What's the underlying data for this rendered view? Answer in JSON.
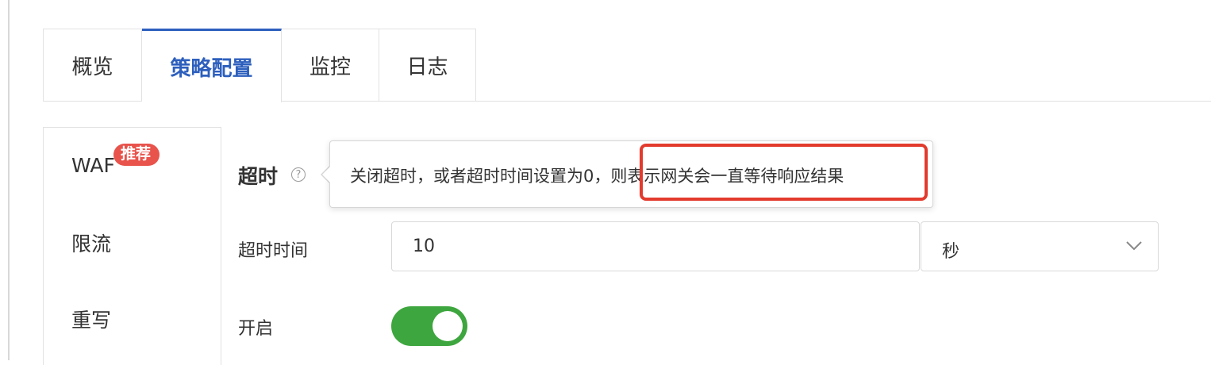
{
  "tabs": [
    {
      "label": "概览"
    },
    {
      "label": "策略配置",
      "active": true
    },
    {
      "label": "监控"
    },
    {
      "label": "日志"
    }
  ],
  "subnav": {
    "items": [
      {
        "label": "WAF"
      },
      {
        "label": "限流"
      },
      {
        "label": "重写"
      }
    ],
    "badge": "推荐"
  },
  "section": {
    "title": "超时",
    "help_icon": "question-circle-icon",
    "tooltip": {
      "text_prefix": "关闭超时，或者超时时间设置为0，",
      "text_highlight": "则表示网关会一直等待响应结果"
    }
  },
  "timeout": {
    "label": "超时时间",
    "value": "10",
    "unit": "秒"
  },
  "enable": {
    "label": "开启",
    "on": true
  },
  "colors": {
    "accent": "#2d5fbd",
    "badge": "#e8534b",
    "toggle_on": "#3ea63e",
    "highlight": "#e23b2e"
  }
}
